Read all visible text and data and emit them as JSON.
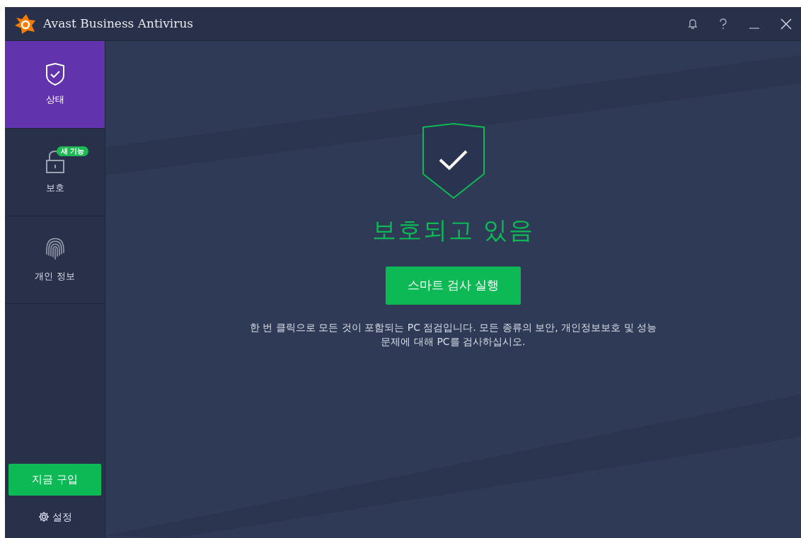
{
  "window": {
    "title": "Avast Business Antivirus"
  },
  "sidebar": {
    "items": [
      {
        "kind": "shield",
        "label": "상태",
        "selected": true
      },
      {
        "kind": "lock",
        "label": "보호",
        "selected": false,
        "badge": "새 기능"
      },
      {
        "kind": "fingerprint",
        "label": "개인 정보",
        "selected": false
      }
    ],
    "buy_button": "지금 구입",
    "settings": "설정"
  },
  "main": {
    "status": "보호되고 있음",
    "scan_button": "스마트 검사 실행",
    "description": "한 번 클릭으로 모든 것이 포함되는 PC 점검입니다. 모든 종류의 보안, 개인정보보호 및 성능 문제에 대해 PC를 검사하십시오."
  }
}
